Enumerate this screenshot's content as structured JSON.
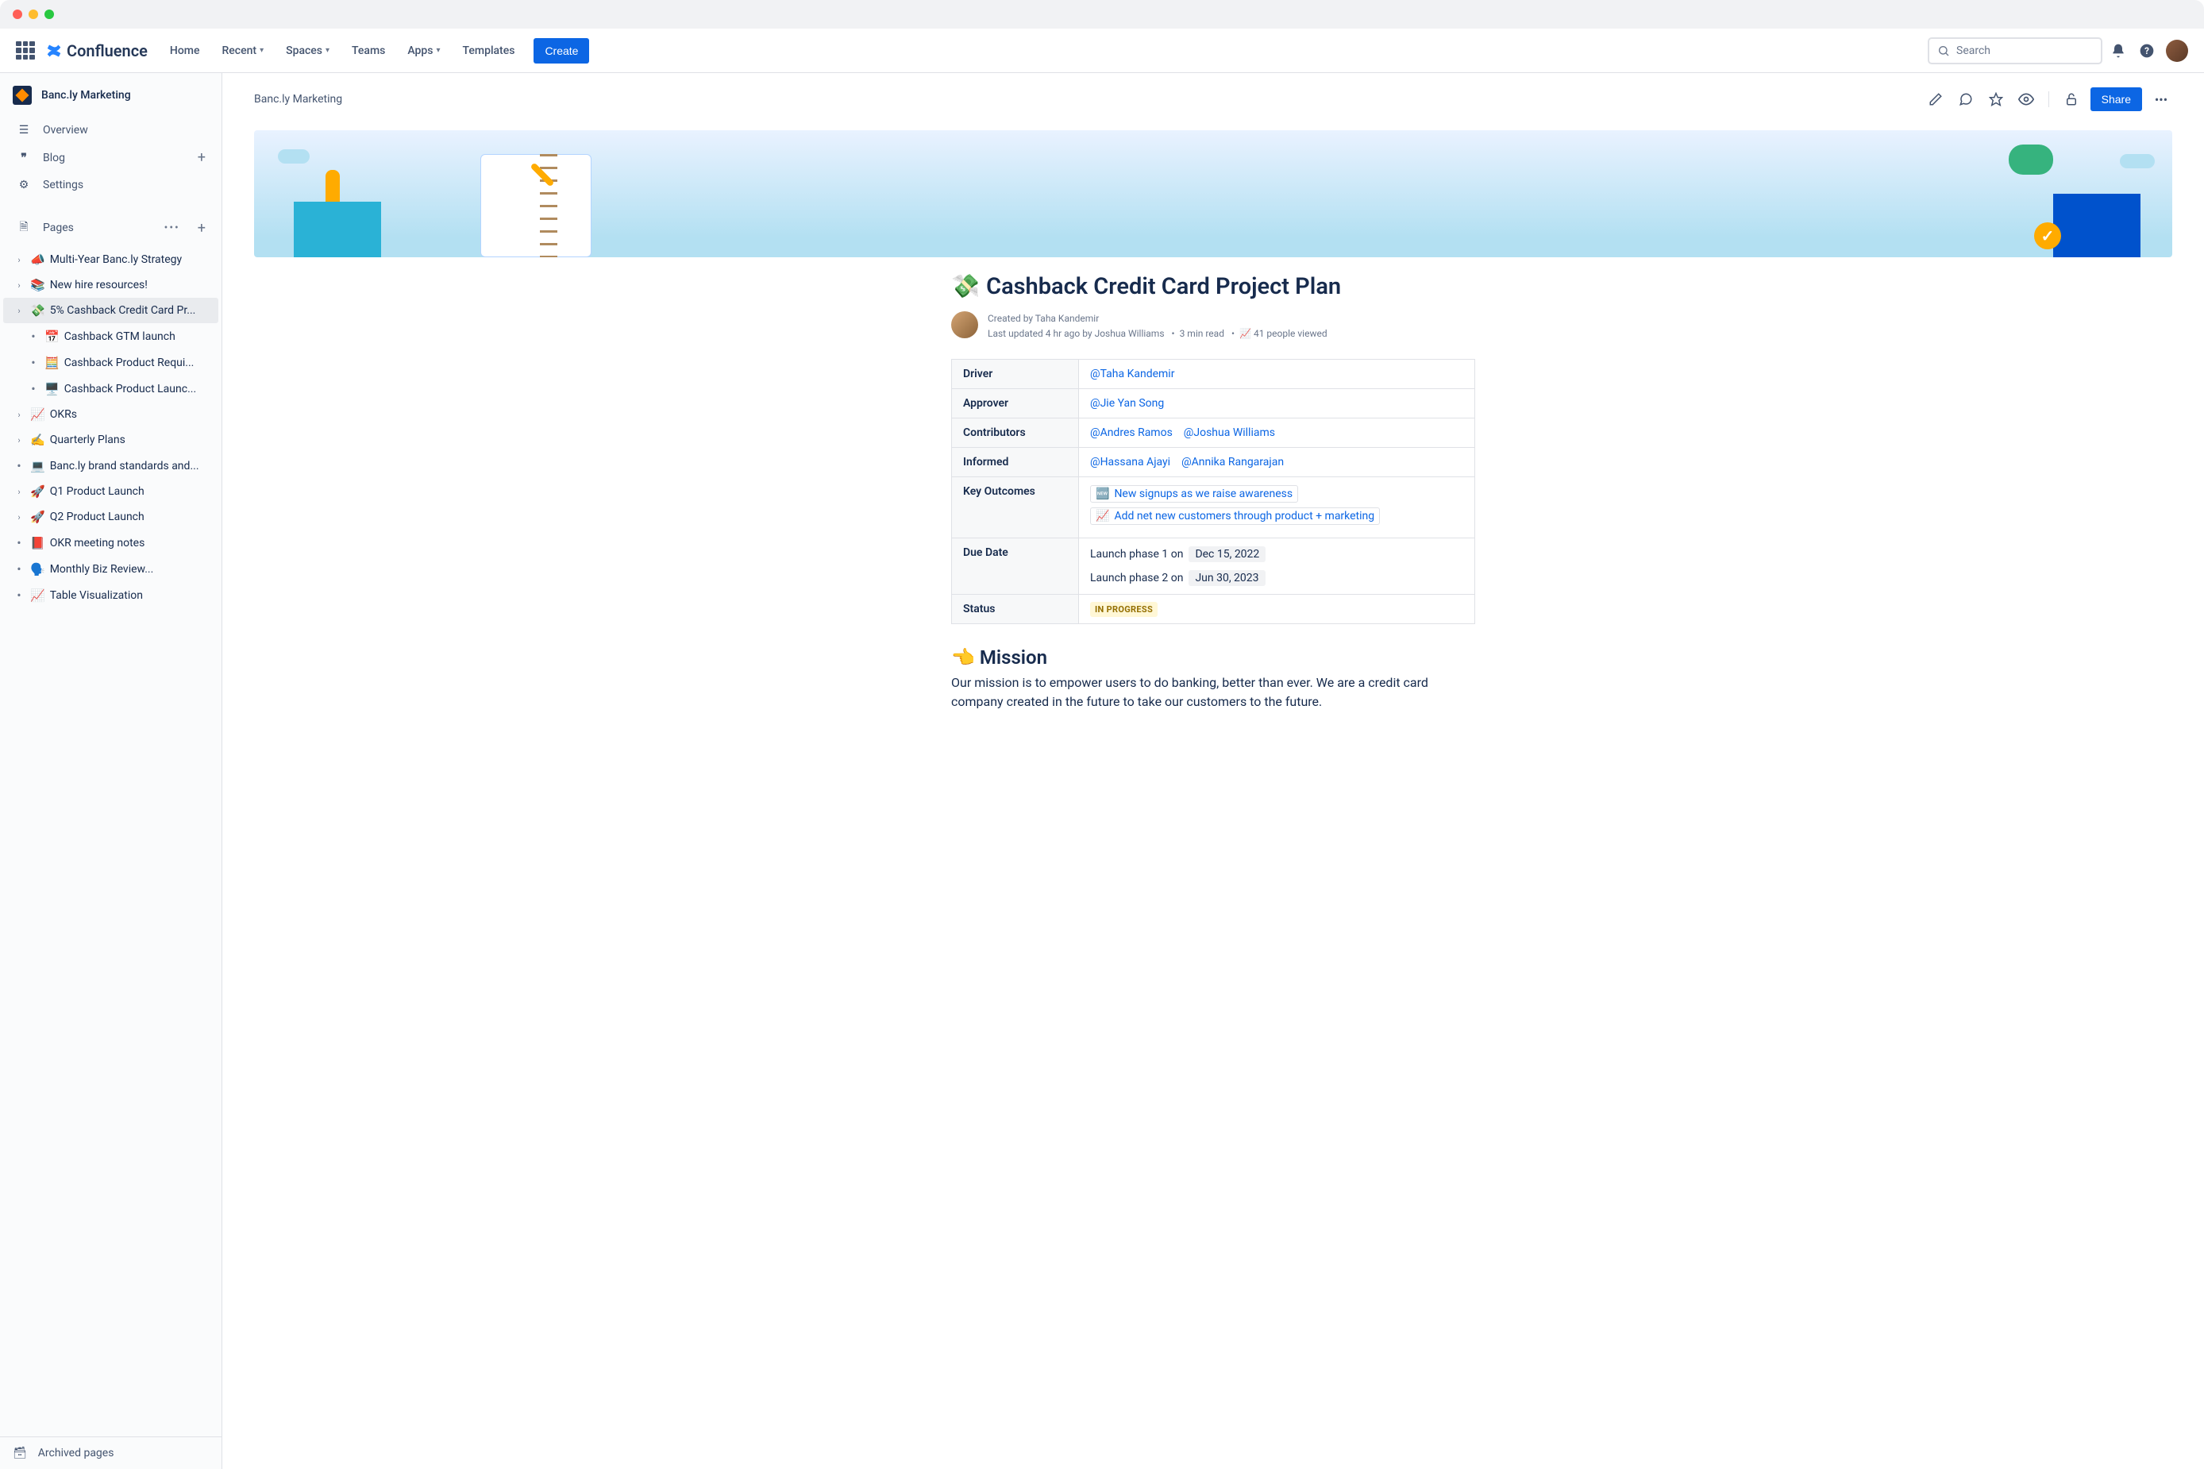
{
  "nav": {
    "product": "Confluence",
    "items": [
      "Home",
      "Recent",
      "Spaces",
      "Teams",
      "Apps",
      "Templates"
    ],
    "dropdown_flags": [
      false,
      true,
      true,
      false,
      true,
      false
    ],
    "create": "Create",
    "search_placeholder": "Search"
  },
  "sidebar": {
    "space": "Banc.ly Marketing",
    "overview": "Overview",
    "blog": "Blog",
    "settings": "Settings",
    "pages_label": "Pages",
    "archived": "Archived pages",
    "tree": [
      {
        "emoji": "📣",
        "label": "Multi-Year Banc.ly Strategy",
        "exp": true,
        "indent": 0
      },
      {
        "emoji": "📚",
        "label": "New hire resources!",
        "exp": true,
        "indent": 0
      },
      {
        "emoji": "💸",
        "label": "5% Cashback Credit Card Pr...",
        "exp": true,
        "indent": 0,
        "selected": true
      },
      {
        "emoji": "📅",
        "label": "Cashback GTM launch",
        "bullet": true,
        "indent": 1
      },
      {
        "emoji": "🧮",
        "label": "Cashback Product Requi...",
        "bullet": true,
        "indent": 1
      },
      {
        "emoji": "🖥️",
        "label": "Cashback Product Launc...",
        "bullet": true,
        "indent": 1
      },
      {
        "emoji": "📈",
        "label": "OKRs",
        "exp": true,
        "indent": 0
      },
      {
        "emoji": "✍️",
        "label": "Quarterly Plans",
        "exp": true,
        "indent": 0
      },
      {
        "emoji": "💻",
        "label": "Banc.ly brand standards and...",
        "bullet": true,
        "indent": 0
      },
      {
        "emoji": "🚀",
        "label": "Q1 Product Launch",
        "exp": true,
        "indent": 0
      },
      {
        "emoji": "🚀",
        "label": "Q2 Product Launch",
        "exp": true,
        "indent": 0
      },
      {
        "emoji": "📕",
        "label": "OKR meeting notes",
        "bullet": true,
        "indent": 0
      },
      {
        "emoji": "🗣️",
        "label": "Monthly Biz Review...",
        "bullet": true,
        "indent": 0
      },
      {
        "emoji": "📈",
        "label": "Table Visualization",
        "bullet": true,
        "indent": 0
      }
    ]
  },
  "page": {
    "breadcrumb": "Banc.ly Marketing",
    "share": "Share",
    "title_emoji": "💸",
    "title": "Cashback Credit Card Project Plan",
    "created_by_label": "Created by ",
    "created_by": "Taha Kandemir",
    "updated_prefix": "Last updated ",
    "updated_time": "4 hr ago",
    "updated_by_prefix": " by ",
    "updated_by": "Joshua Williams",
    "read_time": "3 min read",
    "views": "41 people viewed",
    "table": {
      "driver_label": "Driver",
      "driver": "@Taha Kandemir",
      "approver_label": "Approver",
      "approver": "@Jie Yan Song",
      "contributors_label": "Contributors",
      "contrib1": "@Andres Ramos",
      "contrib2": "@Joshua Williams",
      "informed_label": "Informed",
      "informed1": "@Hassana Ajayi",
      "informed2": "@Annika Rangarajan",
      "outcomes_label": "Key Outcomes",
      "outcome1_emoji": "🆕",
      "outcome1": "New signups as we raise awareness",
      "outcome2_emoji": "📈",
      "outcome2": "Add net new customers through product + marketing",
      "due_label": "Due Date",
      "phase1_label": "Launch phase 1 on",
      "phase1_date": "Dec 15, 2022",
      "phase2_label": "Launch phase 2 on",
      "phase2_date": "Jun 30, 2023",
      "status_label": "Status",
      "status": "IN PROGRESS"
    },
    "mission_emoji": "👈",
    "mission_title": "Mission",
    "mission_body": "Our mission is to empower users to do banking, better than ever. We are a credit card company created in the future to take our customers to the future."
  }
}
